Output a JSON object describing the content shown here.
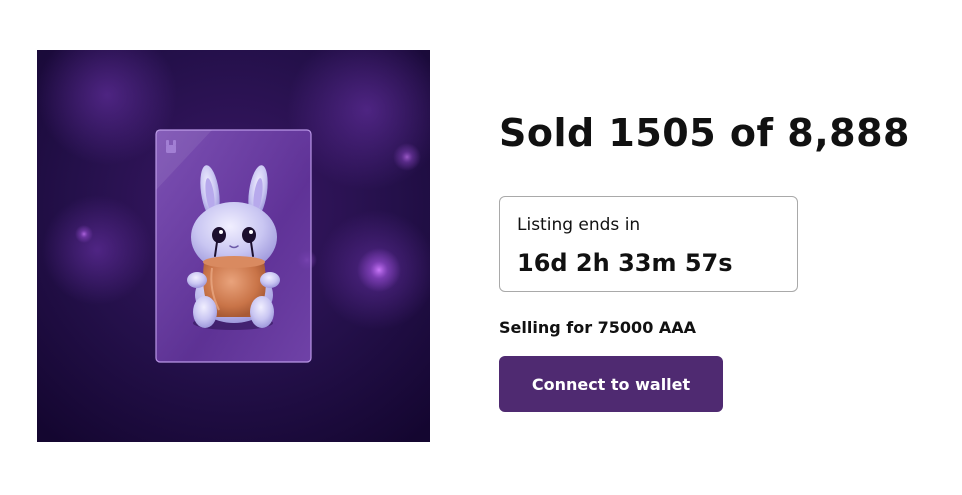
{
  "sale": {
    "title": "Sold 1505 of 8,888",
    "listing_label": "Listing ends in",
    "countdown": "16d 2h 33m 57s",
    "price_text": "Selling for 75000 AAA"
  },
  "actions": {
    "connect_label": "Connect to wallet"
  },
  "artwork": {
    "subject": "bunny-with-pot-card",
    "background_color": "#1d0b3d",
    "accent_color": "#9d4fd8",
    "button_color": "#4f2a71"
  }
}
